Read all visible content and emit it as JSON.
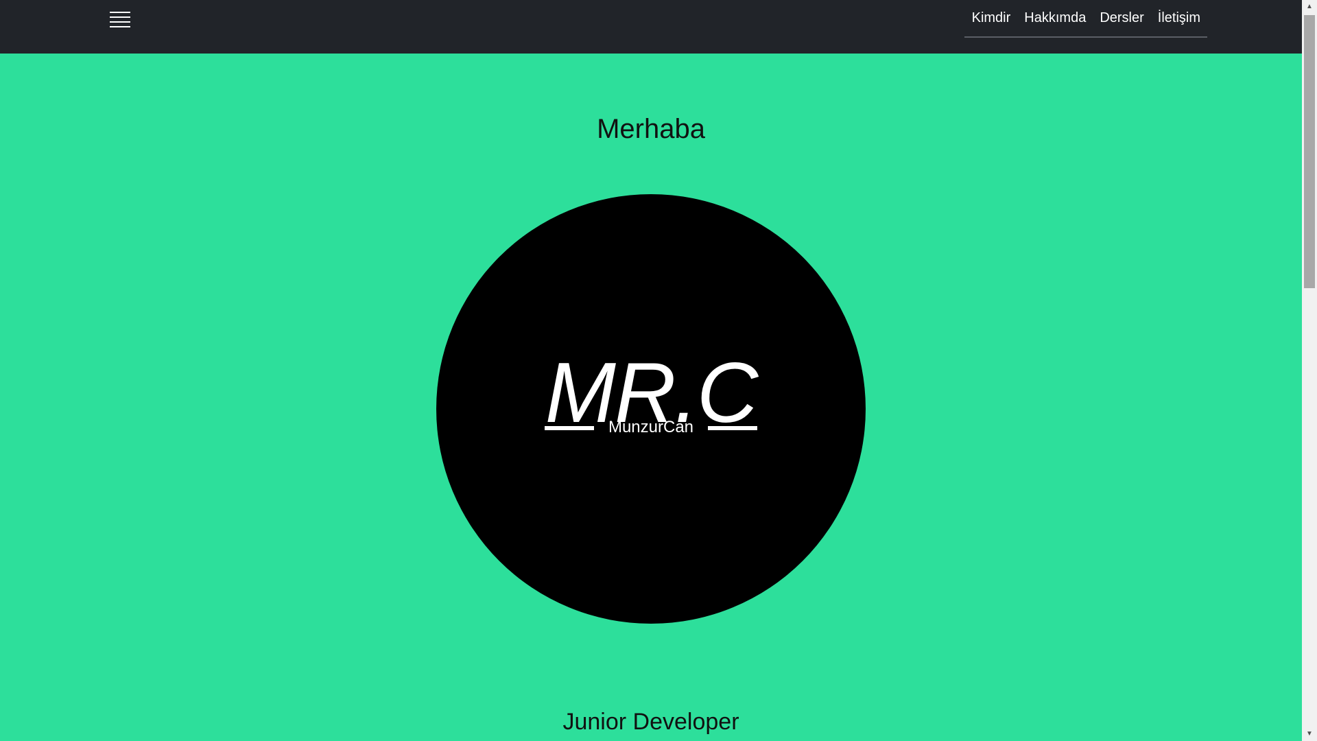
{
  "navbar": {
    "menu_icon": "hamburger-menu-icon",
    "links": [
      {
        "label": "Kimdir"
      },
      {
        "label": "Hakkımda"
      },
      {
        "label": "Dersler"
      },
      {
        "label": "İletişim"
      }
    ]
  },
  "hero": {
    "greeting": "Merhaba",
    "logo_text": "MR.C",
    "logo_subtitle": "MunzurCan",
    "role": "Junior Developer"
  },
  "colors": {
    "navbar_bg": "#212429",
    "page_bg": "#2ddf9b",
    "logo_bg": "#000000",
    "logo_fg": "#ffffff"
  },
  "scrollbar": {
    "up_icon": "scroll-up-arrow-icon",
    "down_icon": "scroll-down-arrow-icon"
  }
}
